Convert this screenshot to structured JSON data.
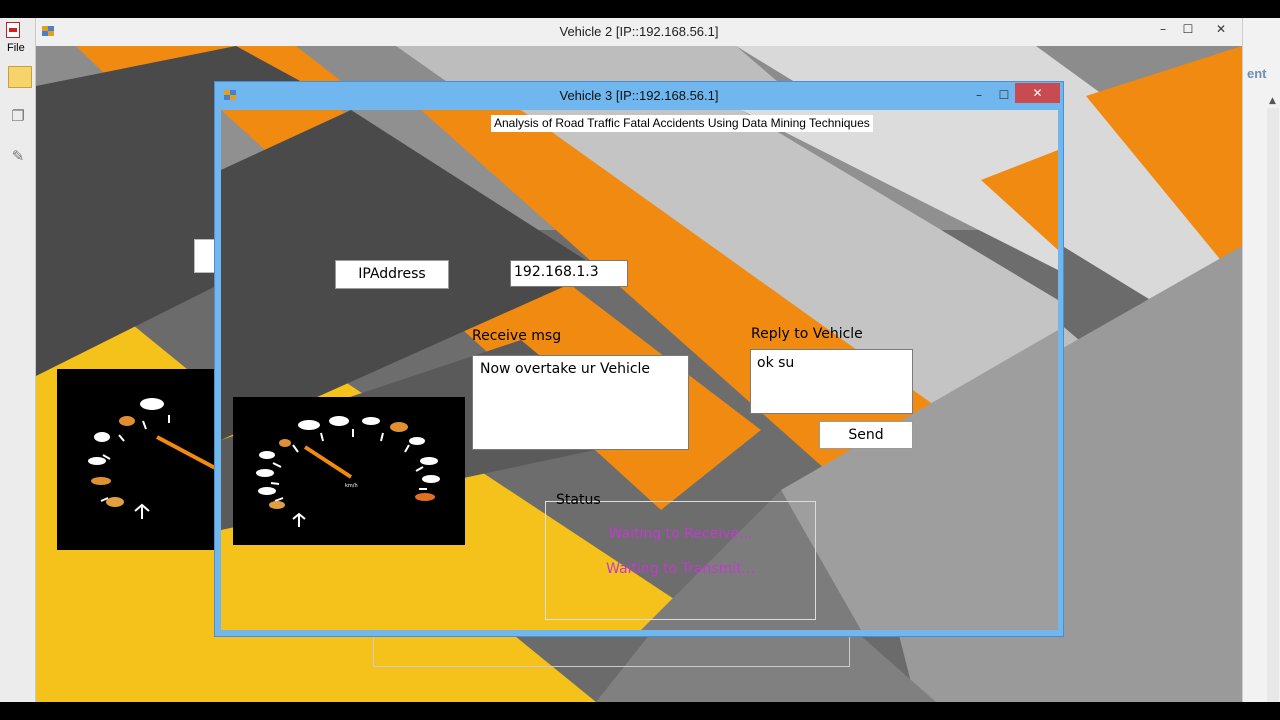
{
  "outer_app": {
    "file_menu": "File",
    "partial_tab_text": "ent"
  },
  "window2": {
    "title": "Vehicle 2 [IP::192.168.56.1]",
    "controls": {
      "minimize": "–",
      "maximize": "☐",
      "close": "✕"
    }
  },
  "window3": {
    "title": "Vehicle 3 [IP::192.168.56.1]",
    "controls": {
      "minimize": "–",
      "maximize": "☐",
      "close": "✕"
    },
    "header": "Analysis of Road Traffic Fatal Accidents Using Data Mining Techniques",
    "ip_button": "IPAddress",
    "ip_value": "192.168.1.3",
    "receive_label": "Receive msg",
    "receive_text": "Now overtake ur Vehicle",
    "reply_label": "Reply to Vehicle",
    "reply_text": "ok su",
    "send_button": "Send",
    "status": {
      "legend": "Status",
      "lines": [
        "Waiting to Receive...",
        "Waiting to Transmit..."
      ]
    }
  },
  "colors": {
    "yellow": "#f5c21b",
    "orange": "#f18a10",
    "status_text": "#c13bd0",
    "active_frame": "#6fb7ee",
    "close_button": "#c74b50"
  },
  "icons": [
    "pdf-icon",
    "folder-icon",
    "pages-icon",
    "attachment-icon",
    "app-icon",
    "speedometer-image"
  ]
}
